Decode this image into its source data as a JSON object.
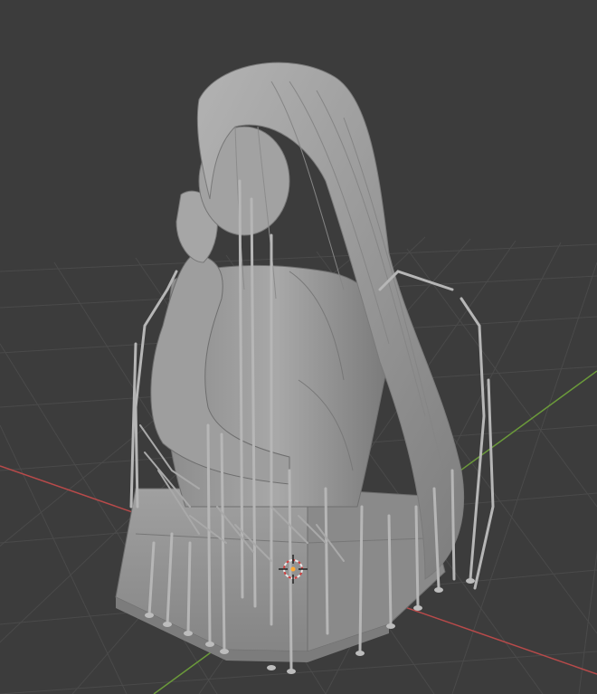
{
  "viewport": {
    "background": "#3c3c3c",
    "grid_color": "#4a4a4a",
    "x_axis_color": "#b84a4a",
    "y_axis_color": "#6b9a3a",
    "model_color": "#9a9a9a",
    "support_color": "#b2b2b2",
    "cursor": "3d-cursor-icon"
  }
}
